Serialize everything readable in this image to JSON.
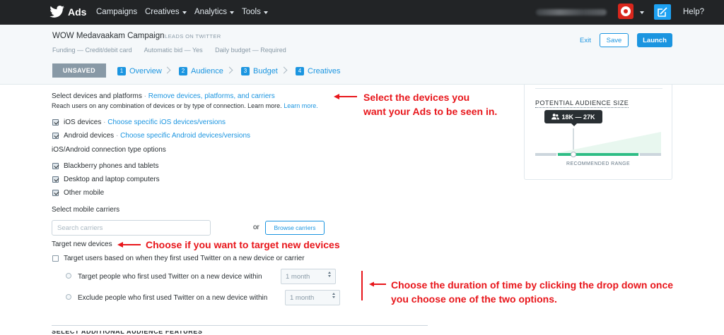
{
  "nav": {
    "brand": "Ads",
    "items": [
      {
        "label": "Campaigns",
        "dropdown": false
      },
      {
        "label": "Creatives",
        "dropdown": true
      },
      {
        "label": "Analytics",
        "dropdown": true
      },
      {
        "label": "Tools",
        "dropdown": true
      }
    ],
    "help": "Help?",
    "icons": {
      "logo": "twitter-bird-icon",
      "avatar": "avatar-image",
      "compose": "compose-icon"
    }
  },
  "campaign": {
    "name": "WOW Medavaakam Campaign",
    "tag": "LEADS ON TWITTER",
    "meta": [
      "Funding — Credit/debit card",
      "Automatic bid — Yes",
      "Daily budget — Required"
    ],
    "exit": "Exit",
    "save": "Save",
    "launch": "Launch",
    "status": "UNSAVED",
    "steps": [
      {
        "num": "1",
        "label": "Overview"
      },
      {
        "num": "2",
        "label": "Audience"
      },
      {
        "num": "3",
        "label": "Budget"
      },
      {
        "num": "4",
        "label": "Creatives"
      }
    ]
  },
  "devices": {
    "heading": "Select devices and platforms",
    "separator": "·",
    "remove_link": "Remove devices, platforms, and carriers",
    "description": "Reach users on any combination of devices or by type of connection. Learn more.",
    "learn_more": "Learn more.",
    "ios_label": "iOS devices",
    "ios_link": "Choose specific iOS devices/versions",
    "android_label": "Android devices",
    "android_link": "Choose specific Android devices/versions",
    "connection_link": "iOS/Android connection type options",
    "blackberry_label": "Blackberry phones and tablets",
    "desktop_label": "Desktop and laptop computers",
    "other_label": "Other mobile"
  },
  "carriers": {
    "heading": "Select mobile carriers",
    "search_placeholder": "Search carriers",
    "or": "or",
    "browse": "Browse carriers"
  },
  "new_devices": {
    "heading": "Target new devices",
    "checkbox_label": "Target users based on when they first used Twitter on a new device or carrier",
    "target_label": "Target people who first used Twitter on a new device within",
    "target_value": "1 month",
    "exclude_label": "Exclude people who first used Twitter on a new device within",
    "exclude_value": "1 month"
  },
  "audience": {
    "title": "POTENTIAL AUDIENCE SIZE",
    "range": "18K — 27K",
    "recommended": "RECOMMENDED RANGE"
  },
  "annotations": {
    "devices_line1": "Select the devices you",
    "devices_line2": "want your Ads to be seen in.",
    "new_devices": "Choose if you want to target new devices",
    "duration_line1": "Choose the duration of time by clicking the drop down once",
    "duration_line2": "you choose one of the two options."
  },
  "colors": {
    "accent": "#1b95e0",
    "annotation": "#e8161b",
    "range": "#2ebd85",
    "nav": "#222426"
  }
}
